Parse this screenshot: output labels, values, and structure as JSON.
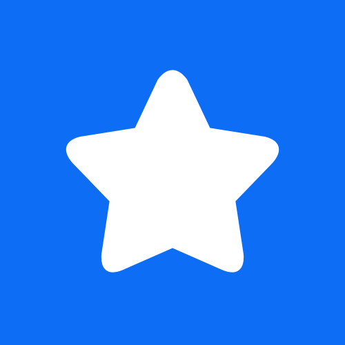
{
  "icon": {
    "name": "star-icon",
    "background_color": "#0d6ef5",
    "foreground_color": "#ffffff"
  }
}
